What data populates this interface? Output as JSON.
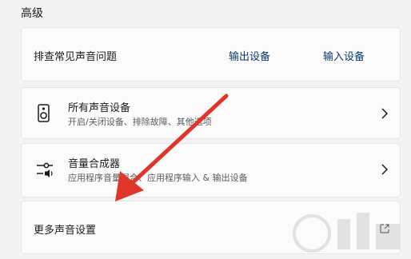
{
  "section": {
    "title": "高级"
  },
  "troubleshoot": {
    "label": "排查常见声音问题",
    "output_link": "输出设备",
    "input_link": "输入设备"
  },
  "devices": {
    "icon": "speaker-icon",
    "title": "所有声音设备",
    "subtitle": "开启/关闭设备、排除故障、其他选项"
  },
  "mixer": {
    "icon": "mixer-icon",
    "title": "音量合成器",
    "subtitle": "应用程序音量混合、应用程序输入 & 输出设备"
  },
  "more": {
    "label": "更多声音设置",
    "icon": "external-link-icon"
  },
  "colors": {
    "background": "#f3f3f3",
    "card": "#fbfbfb",
    "link": "#0a3a6b",
    "annotation_arrow": "#e0352b"
  }
}
